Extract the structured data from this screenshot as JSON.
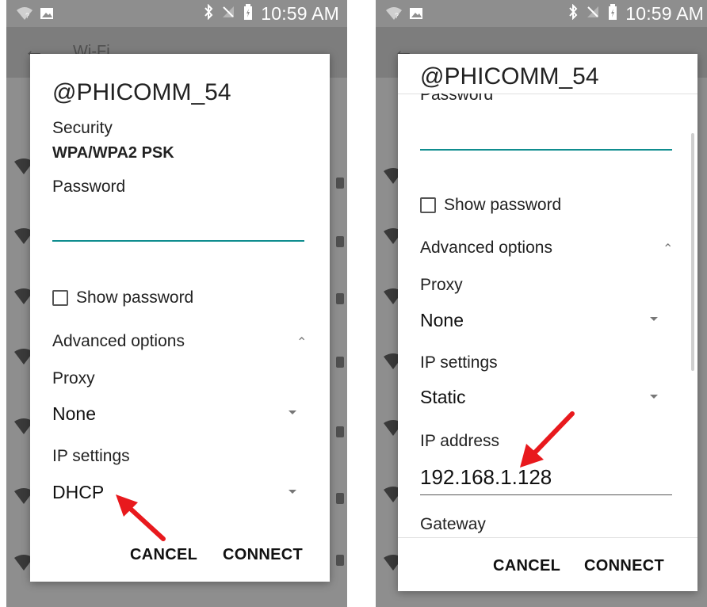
{
  "left": {
    "status": {
      "time": "10:59 AM"
    },
    "appbar": {
      "title": "Wi-Fi"
    },
    "dialog": {
      "title": "@PHICOMM_54",
      "security_label": "Security",
      "security_value": "WPA/WPA2 PSK",
      "password_label": "Password",
      "show_password_label": "Show password",
      "advanced_label": "Advanced options",
      "proxy_label": "Proxy",
      "proxy_value": "None",
      "ip_settings_label": "IP settings",
      "ip_settings_value": "DHCP",
      "cancel_label": "CANCEL",
      "connect_label": "CONNECT"
    }
  },
  "right": {
    "status": {
      "time": "10:59 AM"
    },
    "dialog": {
      "title": "@PHICOMM_54",
      "password_label": "Password",
      "show_password_label": "Show password",
      "advanced_label": "Advanced options",
      "proxy_label": "Proxy",
      "proxy_value": "None",
      "ip_settings_label": "IP settings",
      "ip_settings_value": "Static",
      "ip_address_label": "IP address",
      "ip_address_value": "192.168.1.128",
      "gateway_label": "Gateway",
      "cancel_label": "CANCEL",
      "connect_label": "CONNECT"
    }
  },
  "colors": {
    "accent": "#0f8d8f",
    "arrow": "#e8191d",
    "scrim": "#8e8e8e"
  },
  "icons": [
    "wifi-question-icon",
    "image-icon",
    "bluetooth-icon",
    "no-sim-icon",
    "battery-icon",
    "back-arrow-icon",
    "wifi-signal-icon",
    "lock-icon",
    "chevron-up-icon",
    "dropdown-caret-icon",
    "checkbox-icon"
  ]
}
